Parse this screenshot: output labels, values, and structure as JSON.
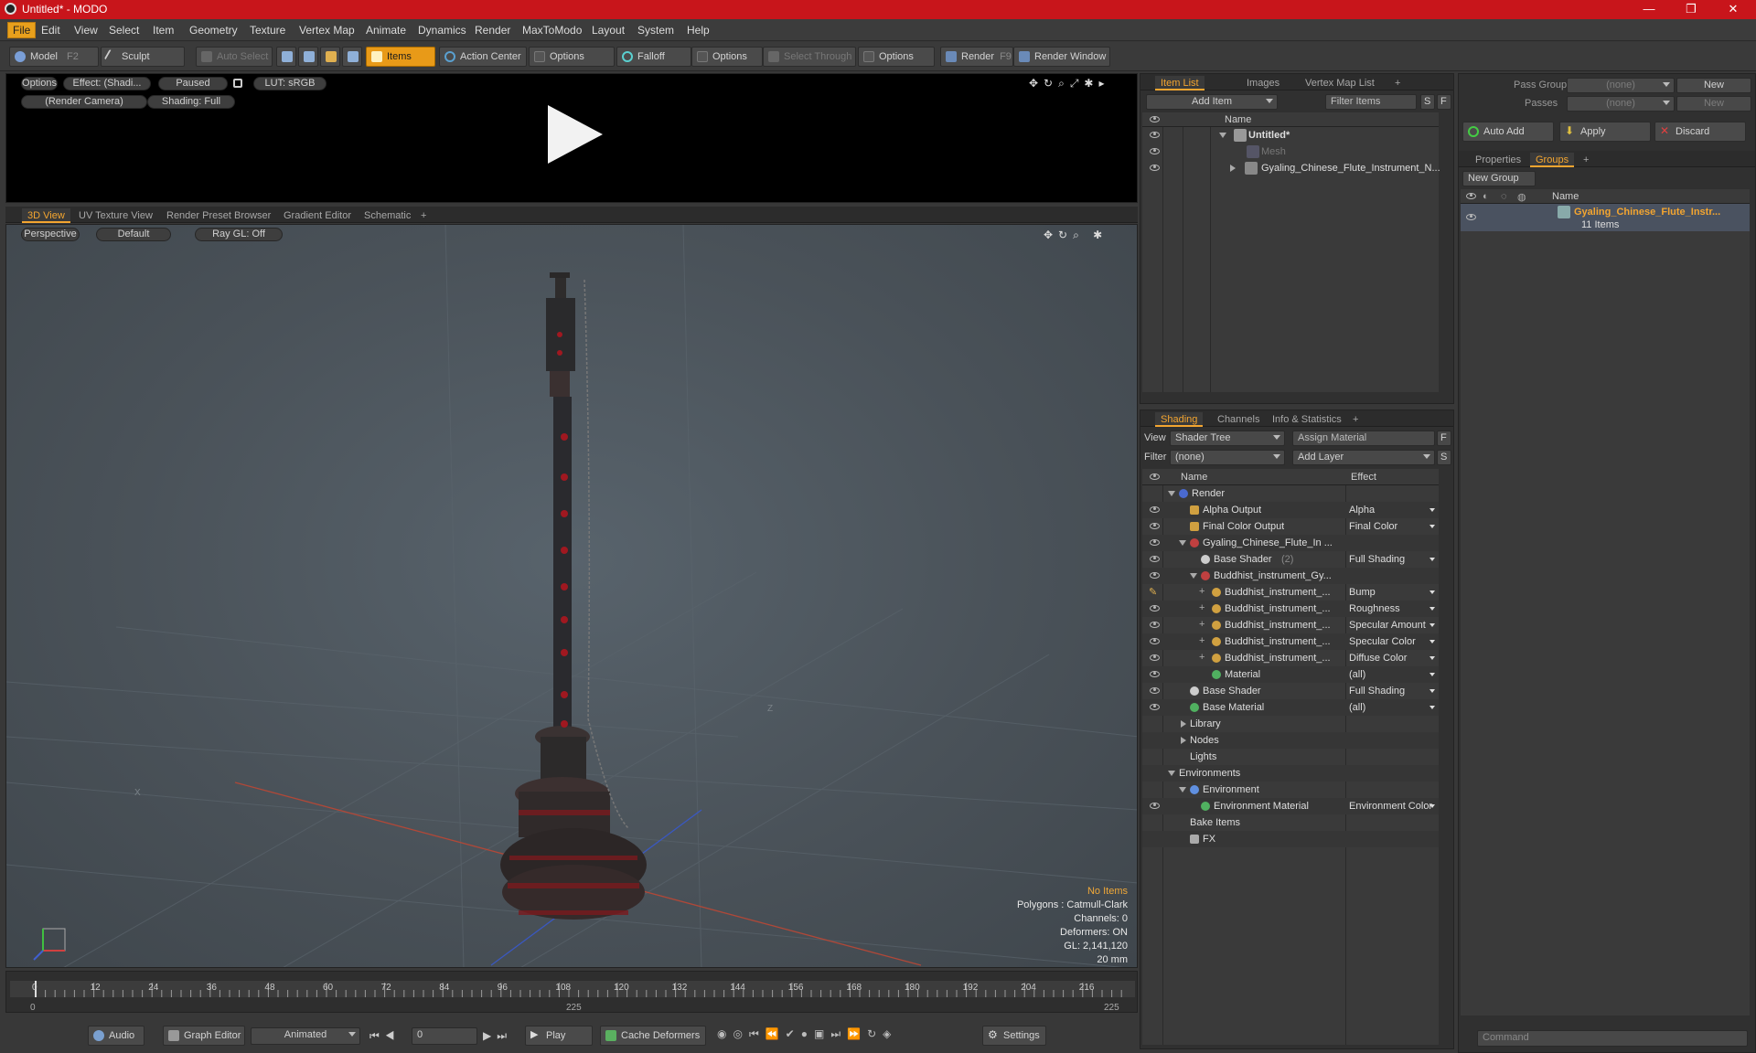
{
  "window": {
    "title": "Untitled* - MODO",
    "minimize": "—",
    "maximize": "❐",
    "close": "✕"
  },
  "menu": [
    "File",
    "Edit",
    "View",
    "Select",
    "Item",
    "Geometry",
    "Texture",
    "Vertex Map",
    "Animate",
    "Dynamics",
    "Render",
    "MaxToModo",
    "Layout",
    "System",
    "Help"
  ],
  "toolbar": {
    "model": "Model",
    "model_key": "F2",
    "sculpt": "Sculpt",
    "auto_select": "Auto Select",
    "items": "Items",
    "action_center": "Action Center",
    "options1": "Options",
    "falloff": "Falloff",
    "options2": "Options",
    "select_through": "Select Through",
    "options3": "Options",
    "render": "Render",
    "render_key": "F9",
    "render_window": "Render Window"
  },
  "preview": {
    "options": "Options",
    "effect": "Effect: (Shadi...",
    "paused": "Paused",
    "lut": "LUT: sRGB",
    "camera": "(Render Camera)",
    "shading": "Shading: Full"
  },
  "viewport_tabs": [
    "3D View",
    "UV Texture View",
    "Render Preset Browser",
    "Gradient Editor",
    "Schematic",
    "+"
  ],
  "viewport": {
    "perspective": "Perspective",
    "default": "Default",
    "raygl": "Ray GL: Off",
    "axis_z": "Z",
    "axis_x": "X",
    "info": {
      "no_items": "No Items",
      "polygons": "Polygons : Catmull-Clark",
      "channels": "Channels: 0",
      "deformers": "Deformers: ON",
      "gl": "GL: 2,141,120",
      "scale": "20 mm"
    }
  },
  "timeline": {
    "ticks": [
      "0",
      "12",
      "24",
      "36",
      "48",
      "60",
      "72",
      "84",
      "96",
      "108",
      "120",
      "132",
      "144",
      "156",
      "168",
      "180",
      "192",
      "204",
      "216"
    ],
    "start": "0",
    "mid": "225",
    "end": "225"
  },
  "transport": {
    "audio": "Audio",
    "graph_editor": "Graph Editor",
    "animated": "Animated",
    "frame": "0",
    "play": "Play",
    "cache_deformers": "Cache Deformers",
    "settings": "Settings"
  },
  "itemlist": {
    "tabs": [
      "Item List",
      "Images",
      "Vertex Map List",
      "+"
    ],
    "add_item": "Add Item",
    "filter": "Filter Items",
    "s": "S",
    "f": "F",
    "col_name": "Name",
    "rows": [
      "Untitled*",
      "Mesh",
      "Gyaling_Chinese_Flute_Instrument_N..."
    ]
  },
  "shading": {
    "tabs": [
      "Shading",
      "Channels",
      "Info & Statistics",
      "+"
    ],
    "view_label": "View",
    "view_value": "Shader Tree",
    "assign": "Assign Material",
    "f": "F",
    "filter_label": "Filter",
    "filter_value": "(none)",
    "add_layer": "Add Layer",
    "s": "S",
    "col_name": "Name",
    "col_effect": "Effect",
    "rows": [
      {
        "name": "Render",
        "effect": ""
      },
      {
        "name": "Alpha Output",
        "effect": "Alpha"
      },
      {
        "name": "Final Color Output",
        "effect": "Final Color"
      },
      {
        "name": "Gyaling_Chinese_Flute_In ...",
        "effect": ""
      },
      {
        "name": "Base Shader",
        "extra": "(2)",
        "effect": "Full Shading"
      },
      {
        "name": "Buddhist_instrument_Gy...",
        "effect": ""
      },
      {
        "name": "Buddhist_instrument_...",
        "effect": "Bump"
      },
      {
        "name": "Buddhist_instrument_...",
        "effect": "Roughness"
      },
      {
        "name": "Buddhist_instrument_...",
        "effect": "Specular Amount"
      },
      {
        "name": "Buddhist_instrument_...",
        "effect": "Specular Color"
      },
      {
        "name": "Buddhist_instrument_...",
        "effect": "Diffuse Color"
      },
      {
        "name": "Material",
        "effect": "(all)"
      },
      {
        "name": "Base Shader",
        "effect": "Full Shading"
      },
      {
        "name": "Base Material",
        "effect": "(all)"
      },
      {
        "name": "Library",
        "effect": ""
      },
      {
        "name": "Nodes",
        "effect": ""
      },
      {
        "name": "Lights",
        "effect": ""
      },
      {
        "name": "Environments",
        "effect": ""
      },
      {
        "name": "Environment",
        "effect": ""
      },
      {
        "name": "Environment Material",
        "effect": "Environment Color"
      },
      {
        "name": "Bake Items",
        "effect": ""
      },
      {
        "name": "FX",
        "effect": ""
      }
    ]
  },
  "groups": {
    "pass_groups": "Pass Groups",
    "pass_groups_value": "(none)",
    "new": "New",
    "passes": "Passes",
    "passes_value": "(none)",
    "new2": "New",
    "auto_add": "Auto Add",
    "apply": "Apply",
    "discard": "Discard",
    "tabs": [
      "Properties",
      "Groups",
      "+"
    ],
    "new_group": "New Group",
    "col_name": "Name",
    "group_name": "Gyaling_Chinese_Flute_Instr...",
    "group_count": "11 Items"
  },
  "command": {
    "placeholder": "Command"
  }
}
